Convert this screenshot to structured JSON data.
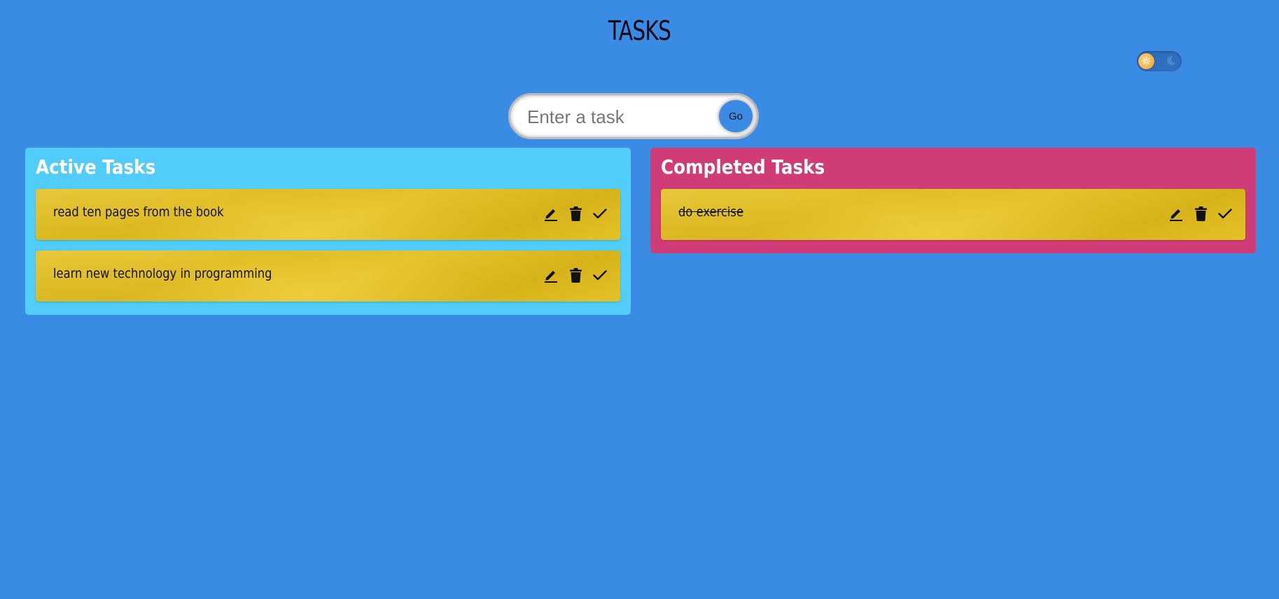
{
  "header": {
    "title": "TASKS"
  },
  "theme_toggle": {
    "state": "light",
    "icons": [
      "sun-icon",
      "moon-icon"
    ]
  },
  "task_form": {
    "placeholder": "Enter a task",
    "value": "",
    "submit_label": "Go"
  },
  "active": {
    "title": "Active Tasks",
    "tasks": [
      {
        "text": "read ten pages from the book"
      },
      {
        "text": "learn new technology in programming"
      }
    ]
  },
  "completed": {
    "title": "Completed Tasks",
    "tasks": [
      {
        "text": "do exercise"
      }
    ]
  },
  "task_actions": [
    "edit-icon",
    "delete-icon",
    "done-icon"
  ],
  "colors": {
    "background": "#3a8be4",
    "active_column": "#52cdf9",
    "completed_column": "#d03c77",
    "task_card": "#eac41c"
  }
}
